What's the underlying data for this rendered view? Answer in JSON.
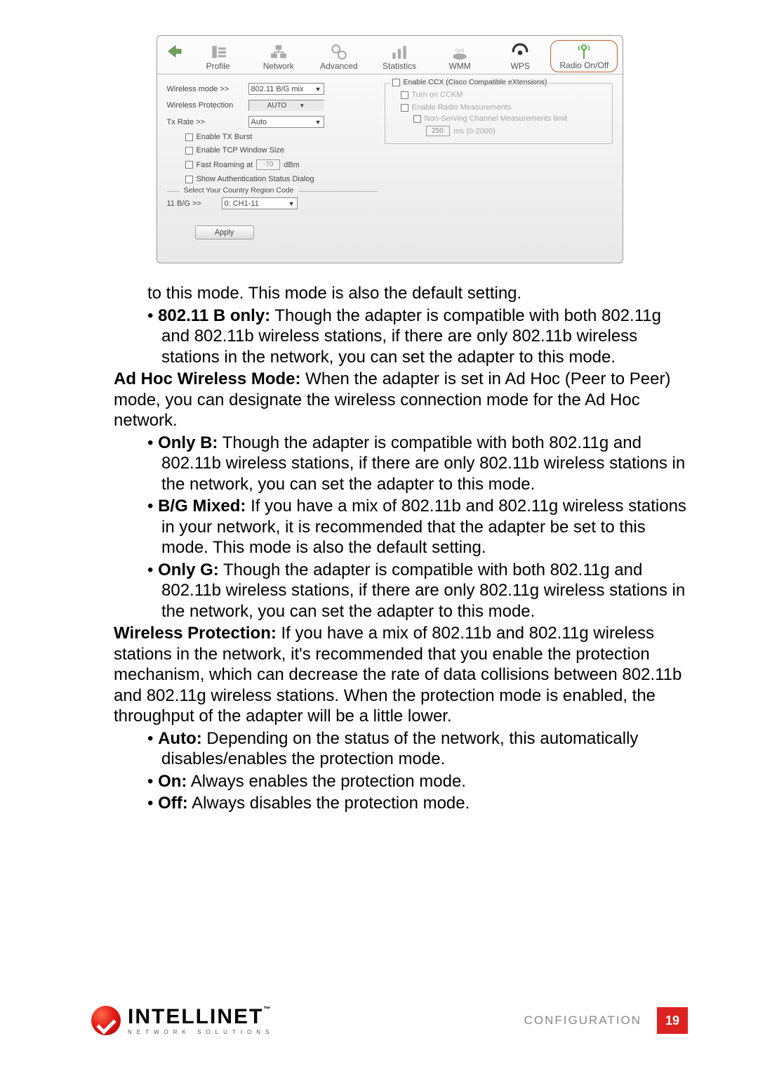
{
  "app": {
    "tabs": {
      "profile": "Profile",
      "network": "Network",
      "advanced": "Advanced",
      "statistics": "Statistics",
      "wmm": "WMM",
      "wps": "WPS",
      "radio": "Radio On/Off"
    },
    "left": {
      "wireless_mode_label": "Wireless mode >>",
      "wireless_mode_value": "802.11 B/G mix",
      "wireless_protection_label": "Wireless Protection",
      "wireless_protection_value": "AUTO",
      "tx_rate_label": "Tx Rate >>",
      "tx_rate_value": "Auto",
      "chk_tx_burst": "Enable TX Burst",
      "chk_tcp_win": "Enable TCP Window Size",
      "chk_fast_roam": "Fast Roaming at",
      "roam_value": "-70",
      "roam_unit": "dBm",
      "chk_auth_dialog": "Show Authentication Status Dialog",
      "region_legend": "Select Your Country Region Code",
      "bg_label": "11 B/G >>",
      "bg_value": "0: CH1-11",
      "apply": "Apply"
    },
    "right": {
      "ccx_legend": "Enable CCX (Cisco Compatible eXtensions)",
      "cckm": "Turn on CCKM",
      "radio_meas": "Enable Radio Measurements",
      "nonserving": "Non-Serving Channel Measurements limit",
      "ms_value": "250",
      "ms_hint": "ms (0-2000)"
    }
  },
  "doc": {
    "p0": "to this mode. This mode is also the default setting.",
    "p1_b": "802.11 B only:",
    "p1_t": " Though the adapter is compatible with both 802.11g and 802.11b wireless stations, if there are only 802.11b wireless stations in the network, you can set the adapter to this mode.",
    "h2_b": "Ad Hoc Wireless Mode:",
    "h2_t": " When the adapter is set in Ad Hoc (Peer to Peer) mode, you can designate the wireless connection mode for the Ad Hoc network.",
    "b1_b": "Only B:",
    "b1_t": " Though the adapter is compatible with both 802.11g and 802.11b wireless stations, if there are only 802.11b wireless stations in the network, you can set the adapter to this mode.",
    "b2_b": "B/G Mixed:",
    "b2_t": " If you have a mix of 802.11b and 802.11g wireless stations in your network, it is recommended that the adapter be set to this mode. This mode is also the default setting.",
    "b3_b": "Only G:",
    "b3_t": " Though the adapter is compatible with both 802.11g and 802.11b wireless stations, if there are only 802.11g wireless stations in the network, you can set the adapter to this mode.",
    "h3_b": "Wireless Protection:",
    "h3_t": " If you have a mix of 802.11b and 802.11g wireless stations in the network, it's recommended that you enable the protection mechanism, which can decrease the rate of data collisions between 802.11b and 802.11g wireless stations. When the protection mode is enabled, the throughput of the adapter will be a little lower.",
    "c1_b": "Auto:",
    "c1_t": " Depending on the status of the network, this automatically disables/enables the protection mode.",
    "c2_b": "On:",
    "c2_t": " Always enables the protection mode.",
    "c3_b": "Off:",
    "c3_t": " Always disables the protection mode."
  },
  "footer": {
    "brand": "INTELLINET",
    "brand_sub": "NETWORK SOLUTIONS",
    "section": "CONFIGURATION",
    "page": "19"
  }
}
